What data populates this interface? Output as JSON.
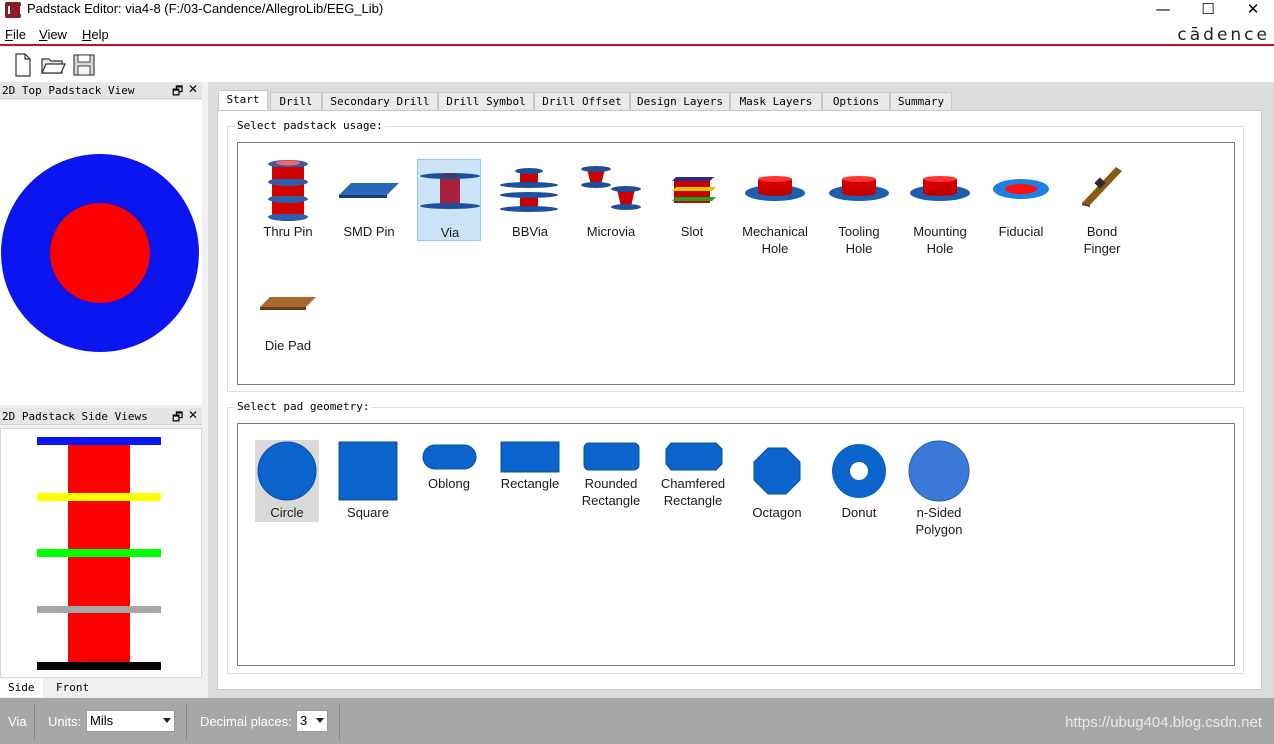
{
  "window": {
    "title": "Padstack Editor: via4-8  (F:/03-Candence/AllegroLib/EEG_Lib)",
    "minimize": "—",
    "maximize": "☐",
    "close": "✕"
  },
  "menu": [
    {
      "label": "File"
    },
    {
      "label": "View"
    },
    {
      "label": "Help"
    }
  ],
  "brand": "cādence",
  "toolbar": {
    "new": "new-file-icon",
    "open": "open-folder-icon",
    "save": "save-disk-icon"
  },
  "left_panels": {
    "top_view": {
      "title": "2D Top Padstack View",
      "float": "🗗",
      "close": "✕"
    },
    "side_view": {
      "title": "2D Padstack Side Views",
      "float": "🗗",
      "close": "✕"
    },
    "side_tabs": [
      "Side",
      "Front"
    ]
  },
  "tabs": [
    "Start",
    "Drill",
    "Secondary Drill",
    "Drill Symbol",
    "Drill Offset",
    "Design Layers",
    "Mask Layers",
    "Options",
    "Summary"
  ],
  "start_page": {
    "usage_label": "Select padstack usage:",
    "usage_items": [
      {
        "label": "Thru Pin"
      },
      {
        "label": "SMD Pin"
      },
      {
        "label": "Via",
        "selected": true
      },
      {
        "label": "BBVia"
      },
      {
        "label": "Microvia"
      },
      {
        "label": "Slot"
      },
      {
        "label": "Mechanical\nHole"
      },
      {
        "label": "Tooling\nHole"
      },
      {
        "label": "Mounting\nHole"
      },
      {
        "label": "Fiducial"
      },
      {
        "label": "Bond\nFinger"
      },
      {
        "label": "Die Pad"
      }
    ],
    "geometry_label": "Select pad geometry:",
    "geometry_items": [
      {
        "label": "Circle",
        "selected": true
      },
      {
        "label": "Square"
      },
      {
        "label": "Oblong"
      },
      {
        "label": "Rectangle"
      },
      {
        "label": "Rounded\nRectangle"
      },
      {
        "label": "Chamfered\nRectangle"
      },
      {
        "label": "Octagon"
      },
      {
        "label": "Donut"
      },
      {
        "label": "n-Sided\nPolygon"
      }
    ]
  },
  "status": {
    "mode": "Via",
    "units_label": "Units:",
    "units_value": "Mils",
    "decimal_label": "Decimal places:",
    "decimal_value": "3",
    "watermark": "https://ubug404.blog.csdn.net"
  },
  "colors": {
    "accent_red": "#c8102e",
    "pad_blue": "#0a15f0",
    "drill_red": "#ff0000",
    "icon_blue": "#0b64cc"
  }
}
